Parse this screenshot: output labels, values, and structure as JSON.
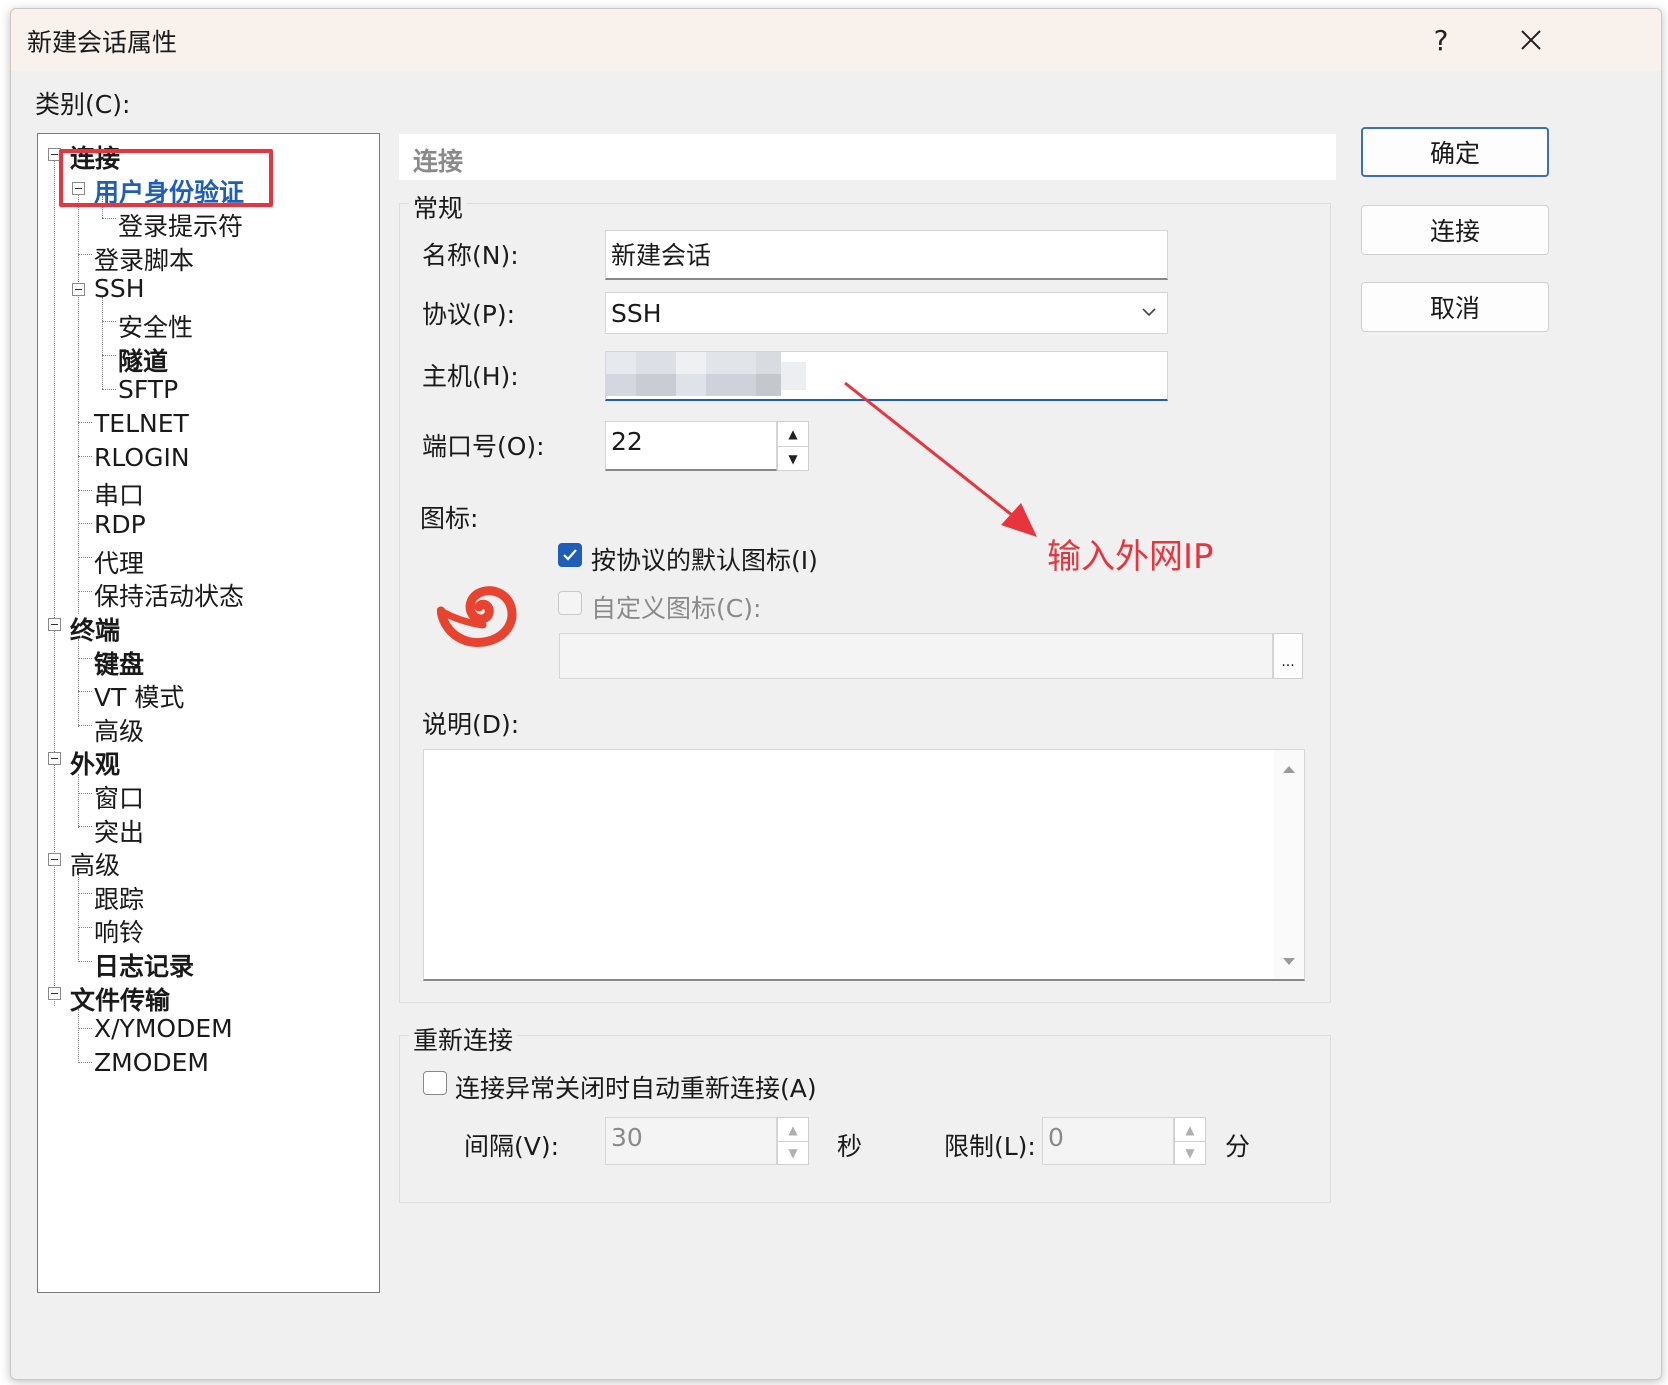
{
  "window": {
    "title": "新建会话属性",
    "help_label": "?",
    "close_label": "✕"
  },
  "category_label": "类别(C):",
  "tree": [
    {
      "label": "连接",
      "bold": true
    },
    {
      "label": "用户身份验证",
      "bold": true,
      "selected": true
    },
    {
      "label": "登录提示符"
    },
    {
      "label": "登录脚本"
    },
    {
      "label": "SSH"
    },
    {
      "label": "安全性"
    },
    {
      "label": "隧道",
      "bold": true
    },
    {
      "label": "SFTP"
    },
    {
      "label": "TELNET"
    },
    {
      "label": "RLOGIN"
    },
    {
      "label": "串口"
    },
    {
      "label": "RDP"
    },
    {
      "label": "代理"
    },
    {
      "label": "保持活动状态"
    },
    {
      "label": "终端",
      "bold": true
    },
    {
      "label": "键盘",
      "bold": true
    },
    {
      "label": "VT 模式"
    },
    {
      "label": "高级"
    },
    {
      "label": "外观",
      "bold": true
    },
    {
      "label": "窗口"
    },
    {
      "label": "突出"
    },
    {
      "label": "高级"
    },
    {
      "label": "跟踪"
    },
    {
      "label": "响铃"
    },
    {
      "label": "日志记录",
      "bold": true
    },
    {
      "label": "文件传输",
      "bold": true
    },
    {
      "label": "X/YMODEM"
    },
    {
      "label": "ZMODEM"
    }
  ],
  "panel": {
    "header": "连接"
  },
  "general": {
    "group_label": "常规",
    "name_label": "名称(N):",
    "name_value": "新建会话",
    "protocol_label": "协议(P):",
    "protocol_value": "SSH",
    "host_label": "主机(H):",
    "host_value": "",
    "port_label": "端口号(O):",
    "port_value": "22",
    "icon_label": "图标:",
    "default_icon_label": "按协议的默认图标(I)",
    "custom_icon_label": "自定义图标(C):",
    "browse_label": "...",
    "description_label": "说明(D):"
  },
  "reconnect": {
    "group_label": "重新连接",
    "auto_reconnect_label": "连接异常关闭时自动重新连接(A)",
    "interval_label": "间隔(V):",
    "interval_value": "30",
    "interval_unit": "秒",
    "limit_label": "限制(L):",
    "limit_value": "0",
    "limit_unit": "分"
  },
  "buttons": {
    "ok": "确定",
    "connect": "连接",
    "cancel": "取消"
  },
  "annotation": {
    "text": "输入外网IP",
    "color": "#e8343d"
  },
  "colors": {
    "accent": "#1e5eb8",
    "selected_tree_text": "#1e5eb8",
    "highlight": "#e8343d"
  }
}
